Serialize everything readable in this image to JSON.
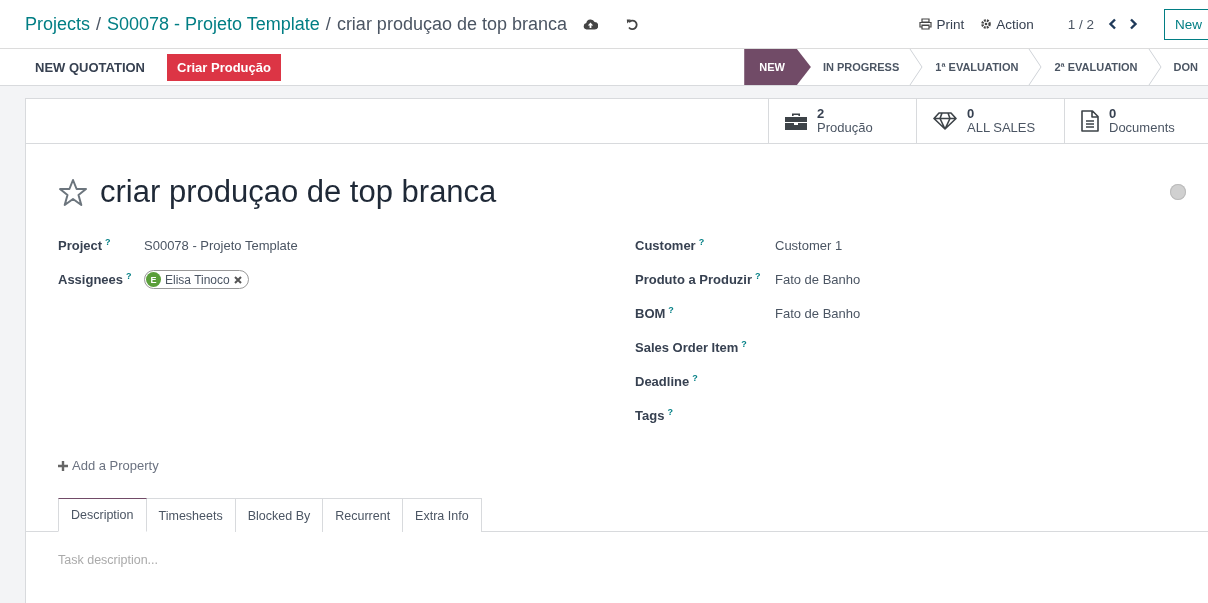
{
  "breadcrumbs": [
    {
      "label": "Projects",
      "kind": "link"
    },
    {
      "label": "S00078 - Projeto Template",
      "kind": "link"
    },
    {
      "label": "criar produçao de top branca",
      "kind": "current"
    }
  ],
  "breadcrumb_separators": [
    "/",
    "/"
  ],
  "toolbar": {
    "print": "Print",
    "action": "Action",
    "pager": "1 / 2",
    "new_button": "New"
  },
  "action_buttons": [
    {
      "label": "NEW QUOTATION",
      "kind": "plain"
    },
    {
      "label": "Criar Produção",
      "kind": "danger"
    }
  ],
  "stages": [
    {
      "label": "NEW",
      "selected": true
    },
    {
      "label": "IN PROGRESS",
      "selected": false
    },
    {
      "label": "1ª EVALUATION",
      "selected": false
    },
    {
      "label": "2ª EVALUATION",
      "selected": false
    },
    {
      "label": "DON",
      "selected": false
    }
  ],
  "smart_buttons": [
    {
      "kind": "briefcase",
      "count": "2",
      "label": "Produção"
    },
    {
      "kind": "diamond",
      "count": "0",
      "label": "ALL SALES"
    },
    {
      "kind": "document",
      "count": "0",
      "label": "Documents"
    }
  ],
  "task": {
    "title": "criar produçao de top branca",
    "starred": false,
    "ready": false
  },
  "left_fields": [
    {
      "label": "Project",
      "help": "?",
      "kind": "text",
      "value": "S00078 - Projeto Template"
    },
    {
      "label": "Assignees",
      "help": "?",
      "kind": "tags",
      "tags": [
        {
          "initial": "E",
          "name": "Elisa Tinoco",
          "color": "#5a9e3a"
        }
      ]
    }
  ],
  "right_fields": [
    {
      "label": "Customer",
      "help": "?",
      "kind": "text",
      "value": "Customer 1"
    },
    {
      "label": "Produto a Produzir",
      "help": "?",
      "kind": "text",
      "value": "Fato de Banho"
    },
    {
      "label": "BOM",
      "help": "?",
      "kind": "text",
      "value": "Fato de Banho"
    },
    {
      "label": "Sales Order Item",
      "help": "?",
      "kind": "empty"
    },
    {
      "label": "Deadline",
      "help": "?",
      "kind": "empty"
    },
    {
      "label": "Tags",
      "help": "?",
      "kind": "empty"
    }
  ],
  "add_property": "Add a Property",
  "tabs": [
    {
      "label": "Description",
      "selected": true
    },
    {
      "label": "Timesheets",
      "selected": false
    },
    {
      "label": "Blocked By",
      "selected": false
    },
    {
      "label": "Recurrent",
      "selected": false
    },
    {
      "label": "Extra Info",
      "selected": false
    }
  ],
  "description": {
    "placeholder": "Task description..."
  }
}
